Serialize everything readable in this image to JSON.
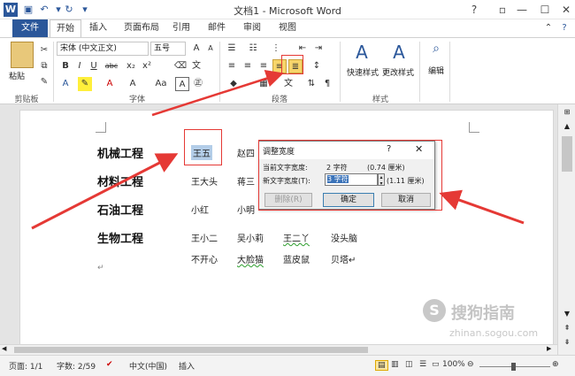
{
  "app": {
    "title": "文档1 - Microsoft Word",
    "help": "?"
  },
  "tabs": [
    "文件",
    "开始",
    "插入",
    "页面布局",
    "引用",
    "邮件",
    "审阅",
    "视图"
  ],
  "ribbon": {
    "clipboard": {
      "paste": "粘贴",
      "label": "剪贴板"
    },
    "font": {
      "name": "宋体 (中文正文)",
      "size": "五号",
      "label": "字体"
    },
    "paragraph": {
      "label": "段落"
    },
    "styles": {
      "quick": "快速样式",
      "change": "更改样式",
      "label": "样式"
    },
    "edit": {
      "label": "编辑"
    }
  },
  "document": {
    "headings": [
      "机械工程",
      "材料工程",
      "石油工程",
      "生物工程"
    ],
    "rows": [
      [
        "王五",
        "赵四"
      ],
      [
        "王大头",
        "蒋三"
      ],
      [
        "小红",
        "小明"
      ],
      [
        "王小二",
        "吴小莉",
        "王二丫",
        "没头脑"
      ],
      [
        "不开心",
        "大脸猫",
        "蓝皮鼠",
        "贝塔↵"
      ]
    ],
    "para_mark": "↵"
  },
  "dialog": {
    "title": "调整宽度",
    "help": "?",
    "current_label": "当前文字宽度:",
    "current_value": "2 字符",
    "current_cm": "(0.74 厘米)",
    "new_label": "新文字宽度(T):",
    "new_value": "3 字符",
    "new_cm": "(1.11 厘米)",
    "remove": "删除(R)",
    "ok": "确定",
    "cancel": "取消"
  },
  "status": {
    "page": "页面: 1/1",
    "words": "字数: 2/59",
    "lang": "中文(中国)",
    "mode": "插入",
    "zoom": "100%"
  },
  "watermark": {
    "brand": "搜狗指南",
    "url": "zhinan.sogou.com"
  },
  "colors": {
    "accent": "#2b579a",
    "annotation": "#e53935",
    "selection": "#b3cde8"
  }
}
